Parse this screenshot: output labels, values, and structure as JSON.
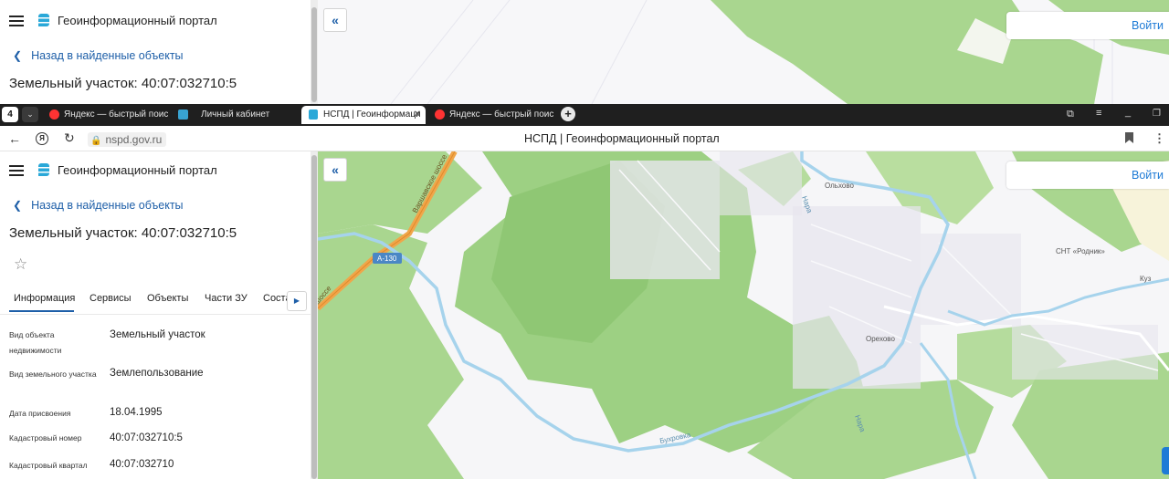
{
  "top_panel": {
    "portal_title": "Геоинформационный портал",
    "back_link": "Назад в найденные объекты",
    "object_title": "Земельный участок: 40:07:032710:5",
    "login_label": "Войти"
  },
  "browser": {
    "tab_count": "4",
    "tabs": [
      {
        "label": "Яндекс — быстрый поиск",
        "active": false
      },
      {
        "label": "Личный кабинет",
        "active": false
      },
      {
        "label": "НСПД | Геоинформаци",
        "active": true
      },
      {
        "label": "Яндекс — быстрый поис",
        "active": false
      }
    ],
    "url": "nspd.gov.ru",
    "page_title": "НСПД | Геоинформационный портал"
  },
  "panel": {
    "portal_title": "Геоинформационный портал",
    "back_link": "Назад в найденные объекты",
    "object_title": "Земельный участок: 40:07:032710:5",
    "tabs": [
      "Информация",
      "Сервисы",
      "Объекты",
      "Части ЗУ",
      "Соста"
    ],
    "properties": [
      {
        "label": "Вид объекта недвижимости",
        "value": "Земельный участок"
      },
      {
        "label": "Вид земельного участка",
        "value": "Землепользование"
      },
      {
        "label": "Дата присвоения",
        "value": "18.04.1995"
      },
      {
        "label": "Кадастровый номер",
        "value": "40:07:032710:5"
      },
      {
        "label": "Кадастровый квартал",
        "value": "40:07:032710"
      }
    ]
  },
  "map": {
    "login_label": "Войти",
    "labels": {
      "road_name": "Варшавское шоссе",
      "road_name_2": "шоссе",
      "road_code": "А-130",
      "village1": "Ольхово",
      "village2": "Орехово",
      "snt": "СНТ «Родник»",
      "kuz": "Куз",
      "river1": "Бухровка",
      "river2": "Нара",
      "river3": "Нара"
    }
  },
  "colors": {
    "forest": "#a9d68f",
    "forest_dark": "#8fc774",
    "river": "#a6d3ec",
    "road": "#f0a64a",
    "link": "#1e5fa8",
    "login": "#1e7bd6"
  }
}
